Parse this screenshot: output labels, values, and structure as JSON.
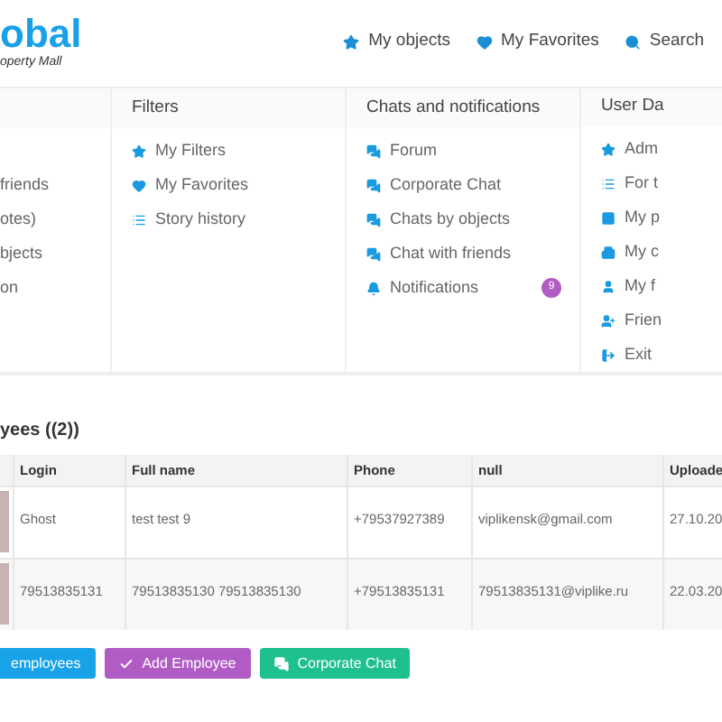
{
  "logo": {
    "title": "obal",
    "subtitle": "operty Mall"
  },
  "nav": [
    {
      "label": "My objects"
    },
    {
      "label": "My Favorites"
    },
    {
      "label": "Search"
    }
  ],
  "menu_columns": [
    {
      "items": [
        {
          "label": "friends"
        },
        {
          "label": "otes)"
        },
        {
          "label": "bjects"
        },
        {
          "label": "on"
        }
      ]
    },
    {
      "title": "Filters",
      "items": [
        {
          "label": "My Filters"
        },
        {
          "label": "My Favorites"
        },
        {
          "label": "Story history"
        }
      ]
    },
    {
      "title": "Chats and notifications",
      "items": [
        {
          "label": "Forum"
        },
        {
          "label": "Corporate Chat"
        },
        {
          "label": "Chats by objects"
        },
        {
          "label": "Chat with friends"
        },
        {
          "label": "Notifications",
          "badge": "9"
        }
      ]
    },
    {
      "title": "User Da",
      "items": [
        {
          "label": "Adm"
        },
        {
          "label": "For t"
        },
        {
          "label": "My p"
        },
        {
          "label": "My c"
        },
        {
          "label": "My f"
        },
        {
          "label": "Frien"
        },
        {
          "label": "Exit"
        }
      ]
    }
  ],
  "section_title": "yees ((2))",
  "table": {
    "columns": [
      "Login",
      "Full name",
      "Phone",
      "null",
      "Uploade"
    ],
    "rows": [
      [
        "Ghost",
        "test test 9",
        "+79537927389",
        "viplikensk@gmail.com",
        "27.10.20"
      ],
      [
        "79513835131",
        "79513835130 79513835130",
        "+79513835131",
        "79513835131@viplike.ru",
        "22.03.20"
      ]
    ]
  },
  "buttons": [
    {
      "kind": "employees",
      "label": "employees"
    },
    {
      "kind": "add",
      "label": "Add Employee"
    },
    {
      "kind": "chat",
      "label": "Corporate Chat"
    }
  ]
}
